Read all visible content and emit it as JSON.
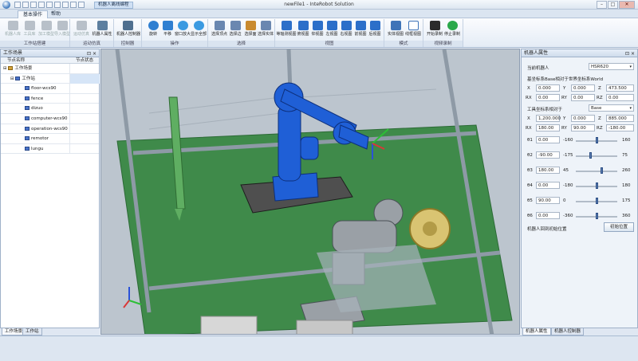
{
  "window": {
    "title": "newFile1 - InteRobot Solution",
    "context_tab": "机器人离线编程",
    "controls": {
      "minimize": "–",
      "maximize": "□",
      "close": "✕"
    }
  },
  "ribbon_tabs": [
    {
      "label": "基本操作",
      "active": true
    },
    {
      "label": "帮助",
      "active": false
    }
  ],
  "ribbon_groups": [
    {
      "label": "工作站搭建",
      "buttons": [
        {
          "label": "机器人库",
          "icon": "robot-library-icon",
          "enabled": false
        },
        {
          "label": "工具库",
          "icon": "tool-library-icon",
          "enabled": false
        },
        {
          "label": "加工模型",
          "icon": "workpiece-icon",
          "enabled": false
        },
        {
          "label": "导入模型",
          "icon": "import-model-icon",
          "enabled": false
        }
      ]
    },
    {
      "label": "运动仿真",
      "buttons": [
        {
          "label": "运动仿真",
          "icon": "motion-sim-icon",
          "enabled": false
        },
        {
          "label": "机器人属性",
          "icon": "robot-properties-icon",
          "enabled": true
        }
      ]
    },
    {
      "label": "控制器",
      "buttons": [
        {
          "label": "机器人控制器",
          "icon": "robot-controller-icon",
          "enabled": true
        }
      ]
    },
    {
      "label": "操作",
      "buttons": [
        {
          "label": "旋转",
          "icon": "rotate-icon",
          "enabled": true
        },
        {
          "label": "平移",
          "icon": "pan-icon",
          "enabled": true
        },
        {
          "label": "窗口放大",
          "icon": "zoom-window-icon",
          "enabled": true
        },
        {
          "label": "显示全部",
          "icon": "zoom-fit-icon",
          "enabled": true
        }
      ]
    },
    {
      "label": "选择",
      "buttons": [
        {
          "label": "选择顶点",
          "icon": "select-vertex-icon",
          "enabled": true
        },
        {
          "label": "选择边",
          "icon": "select-edge-icon",
          "enabled": true
        },
        {
          "label": "选择面",
          "icon": "select-face-icon",
          "enabled": true
        },
        {
          "label": "选择实体",
          "icon": "select-solid-icon",
          "enabled": true
        }
      ]
    },
    {
      "label": "视图",
      "buttons": [
        {
          "label": "等轴测视图",
          "icon": "iso-view-icon",
          "enabled": true
        },
        {
          "label": "俯视图",
          "icon": "top-view-icon",
          "enabled": true
        },
        {
          "label": "仰视图",
          "icon": "bottom-view-icon",
          "enabled": true
        },
        {
          "label": "左视图",
          "icon": "left-view-icon",
          "enabled": true
        },
        {
          "label": "右视图",
          "icon": "right-view-icon",
          "enabled": true
        },
        {
          "label": "前视图",
          "icon": "front-view-icon",
          "enabled": true
        },
        {
          "label": "后视图",
          "icon": "back-view-icon",
          "enabled": true
        }
      ]
    },
    {
      "label": "模式",
      "buttons": [
        {
          "label": "实体视图",
          "icon": "solid-view-icon",
          "enabled": true
        },
        {
          "label": "线框视图",
          "icon": "wireframe-view-icon",
          "enabled": true
        }
      ]
    },
    {
      "label": "视频录制",
      "buttons": [
        {
          "label": "开始录制",
          "icon": "record-start-icon",
          "enabled": true
        },
        {
          "label": "停止录制",
          "icon": "record-stop-icon",
          "enabled": true
        }
      ]
    }
  ],
  "left_panel": {
    "title": "工作场景",
    "columns": [
      "节点名称",
      "节点状态"
    ],
    "tree": [
      {
        "label": "工作场景",
        "level": 0
      },
      {
        "label": "工作站",
        "level": 1
      },
      {
        "label": "floor-wcs90",
        "level": 2
      },
      {
        "label": "fence",
        "level": 2
      },
      {
        "label": "dizuo",
        "level": 2
      },
      {
        "label": "computer-wcs90",
        "level": 2
      },
      {
        "label": "operation-wcs90",
        "level": 2
      },
      {
        "label": "remotor",
        "level": 2
      },
      {
        "label": "lungu",
        "level": 2
      }
    ],
    "bottom_tabs": [
      "工作场景",
      "工作站"
    ]
  },
  "right_panel": {
    "title": "机器人属性",
    "current_robot_label": "当前机器人",
    "current_robot": "HSR620",
    "base_section": "基坐标系Base相对于世界坐标系World",
    "base": {
      "X": "0.000",
      "Y": "0.000",
      "Z": "473.500",
      "RX": "0.00",
      "RY": "0.00",
      "RZ": "0.00"
    },
    "tool_section": "工具坐标系相对于",
    "tool_ref": "Base",
    "tool": {
      "X": "1,200.000",
      "Y": "0.000",
      "Z": "885.000",
      "RX": "180.00",
      "RY": "90.00",
      "RZ": "-180.00"
    },
    "joints": [
      {
        "name": "θ1",
        "value": "0.00",
        "min": "-160",
        "max": "160",
        "position": 0.5
      },
      {
        "name": "θ2",
        "value": "-90.00",
        "min": "-175",
        "max": "75",
        "position": 0.34
      },
      {
        "name": "θ3",
        "value": "180.00",
        "min": "45",
        "max": "260",
        "position": 0.63
      },
      {
        "name": "θ4",
        "value": "0.00",
        "min": "-180",
        "max": "180",
        "position": 0.5
      },
      {
        "name": "θ5",
        "value": "90.00",
        "min": "0",
        "max": "175",
        "position": 0.51
      },
      {
        "name": "θ6",
        "value": "0.00",
        "min": "-360",
        "max": "360",
        "position": 0.5
      }
    ],
    "reset_label": "机器人回到初始位置",
    "reset_button": "初始位置",
    "bottom_tabs": [
      "机器人属性",
      "机器人控制器"
    ]
  },
  "colors": {
    "robot": "#1f5fd6",
    "floor": "#3f8a4a",
    "accent": "#4f86c6"
  }
}
